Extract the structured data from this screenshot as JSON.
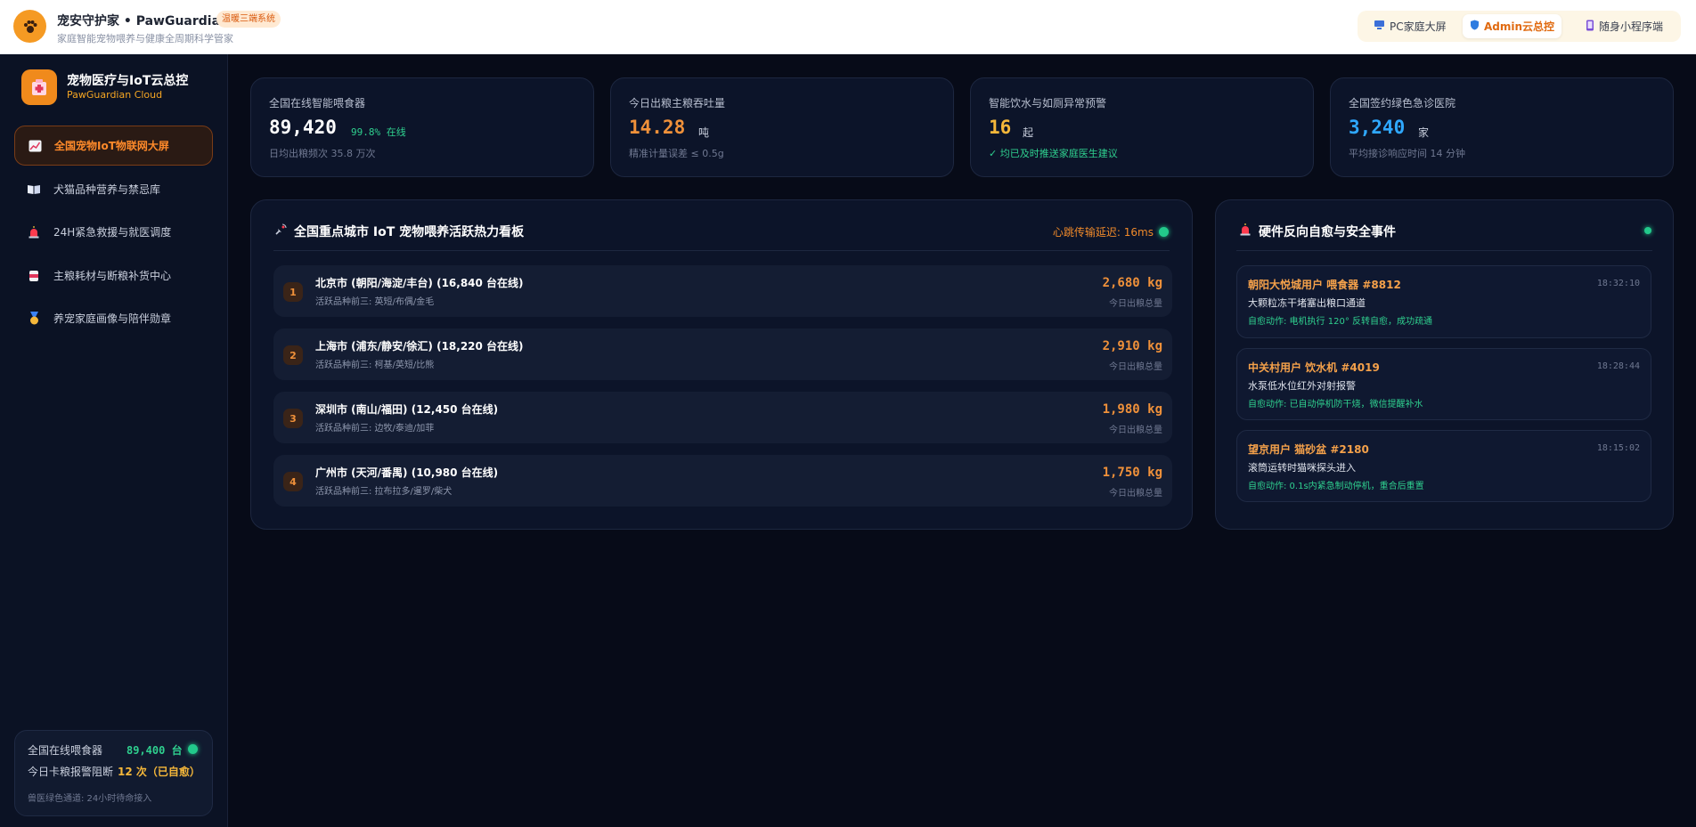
{
  "header": {
    "app_title": "宠安守护家 • PawGuardian",
    "badge": "温暖三端系统",
    "subtitle": "家庭智能宠物喂养与健康全周期科学管家",
    "switcher": [
      {
        "label": "PC家庭大屏",
        "icon": "monitor-icon"
      },
      {
        "label": "Admin云总控",
        "icon": "shield-icon"
      },
      {
        "label": "随身小程序端",
        "icon": "phone-icon"
      }
    ],
    "active_tab": "Admin云总控"
  },
  "sidebar": {
    "brand_title": "宠物医疗与IoT云总控",
    "brand_sub": "PawGuardian Cloud",
    "items": [
      {
        "label": "全国宠物IoT物联网大屏",
        "icon": "chart-icon"
      },
      {
        "label": "犬猫品种营养与禁忌库",
        "icon": "book-icon"
      },
      {
        "label": "24H紧急救援与就医调度",
        "icon": "siren-icon"
      },
      {
        "label": "主粮耗材与断粮补货中心",
        "icon": "can-icon"
      },
      {
        "label": "养宠家庭画像与陪伴勋章",
        "icon": "medal-icon"
      }
    ],
    "stats": {
      "feeders_label": "全国在线喂食器",
      "feeders_value": "89,400 台",
      "jam_label": "今日卡粮报警阻断",
      "jam_value": "12 次（已自愈）",
      "footer": "兽医绿色通道: 24小时待命接入"
    }
  },
  "stats": [
    {
      "label": "全国在线智能喂食器",
      "value": "89,420",
      "unit": "99.8% 在线",
      "foot": "日均出粮频次 35.8 万次",
      "value_color": "#ffffff",
      "unit_color": "#2fd08f"
    },
    {
      "label": "今日出粮主粮吞吐量",
      "value": "14.28",
      "unit": "吨",
      "foot": "精准计量误差 ≤ 0.5g",
      "value_color": "#f0913a",
      "unit_color": "#c9cfdd"
    },
    {
      "label": "智能饮水与如厕异常预警",
      "value": "16",
      "unit": "起",
      "foot": "✓ 均已及时推送家庭医生建议",
      "value_color": "#f5b73a",
      "unit_color": "#c9cfdd",
      "foot_color": "#2fd08f"
    },
    {
      "label": "全国签约绿色急诊医院",
      "value": "3,240",
      "unit": "家",
      "foot": "平均接诊响应时间 14 分钟",
      "value_color": "#2fa8ff",
      "unit_color": "#c9cfdd"
    }
  ],
  "heatmap": {
    "title": "全国重点城市 IoT 宠物喂养活跃热力看板",
    "latency": "心跳传输延迟: 16ms",
    "rows": [
      {
        "rank": "1",
        "name": "北京市 (朝阳/海淀/丰台) (16,840 台在线)",
        "breeds": "活跃品种前三: 英短/布偶/金毛",
        "amount": "2,680 kg",
        "note": "今日出粮总量"
      },
      {
        "rank": "2",
        "name": "上海市 (浦东/静安/徐汇) (18,220 台在线)",
        "breeds": "活跃品种前三: 柯基/英短/比熊",
        "amount": "2,910 kg",
        "note": "今日出粮总量"
      },
      {
        "rank": "3",
        "name": "深圳市 (南山/福田) (12,450 台在线)",
        "breeds": "活跃品种前三: 边牧/泰迪/加菲",
        "amount": "1,980 kg",
        "note": "今日出粮总量"
      },
      {
        "rank": "4",
        "name": "广州市 (天河/番禺) (10,980 台在线)",
        "breeds": "活跃品种前三: 拉布拉多/暹罗/柴犬",
        "amount": "1,750 kg",
        "note": "今日出粮总量"
      }
    ]
  },
  "events": {
    "title": "硬件反向自愈与安全事件",
    "items": [
      {
        "title": "朝阳大悦城用户 喂食器 #8812",
        "time": "18:32:10",
        "desc": "大颗粒冻干堵塞出粮口通道",
        "action": "自愈动作: 电机执行 120° 反转自愈，成功疏通"
      },
      {
        "title": "中关村用户 饮水机 #4019",
        "time": "18:28:44",
        "desc": "水泵低水位红外对射报警",
        "action": "自愈动作: 已自动停机防干烧，微信提醒补水"
      },
      {
        "title": "望京用户 猫砂盆 #2180",
        "time": "18:15:02",
        "desc": "滚筒运转时猫咪探头进入",
        "action": "自愈动作: 0.1s内紧急制动停机，重合后重置"
      }
    ]
  }
}
